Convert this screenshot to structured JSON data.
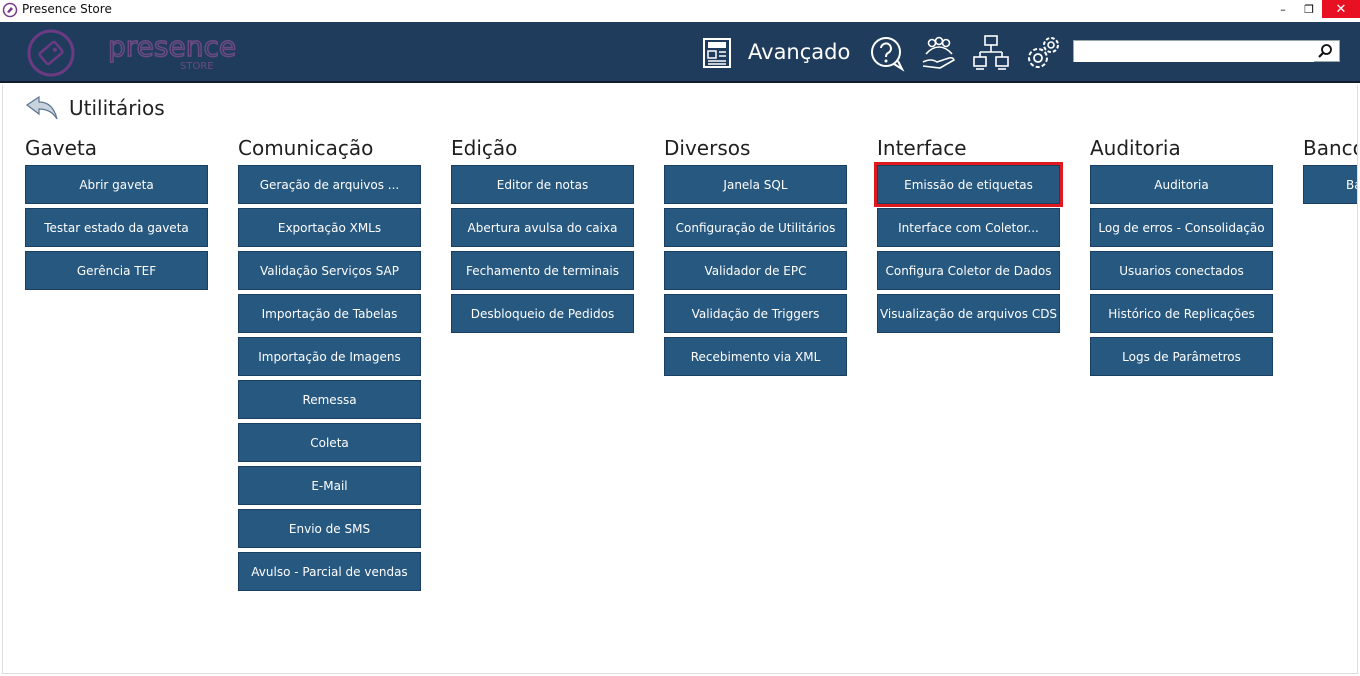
{
  "window": {
    "title": "Presence Store",
    "minimize": "–",
    "restore": "❐",
    "close": "✕"
  },
  "header": {
    "brand": "presence",
    "brand_sub": "STORE",
    "mode_label": "Avançado",
    "search_value": "",
    "icons": [
      "news-icon",
      "help-icon",
      "users-icon",
      "network-icon",
      "settings-icon",
      "search-icon"
    ],
    "colors": {
      "bg": "#203c5c",
      "button": "#275880",
      "highlight": "#e0191e"
    }
  },
  "page": {
    "title": "Utilitários"
  },
  "groups": [
    {
      "title": "Gaveta",
      "buttons": [
        "Abrir gaveta",
        "Testar estado da gaveta",
        "Gerência TEF"
      ]
    },
    {
      "title": "Comunicação",
      "buttons": [
        "Geração de arquivos ...",
        "Exportação XMLs",
        "Validação Serviços SAP",
        "Importação de Tabelas",
        "Importação de Imagens",
        "Remessa",
        "Coleta",
        "E-Mail",
        "Envio de SMS",
        "Avulso - Parcial de vendas"
      ]
    },
    {
      "title": "Edição",
      "buttons": [
        "Editor de notas",
        "Abertura avulsa do caixa",
        "Fechamento de terminais",
        "Desbloqueio de Pedidos"
      ]
    },
    {
      "title": "Diversos",
      "buttons": [
        "Janela SQL",
        "Configuração de Utilitários",
        "Validador de EPC",
        "Validação de Triggers",
        "Recebimento via XML"
      ]
    },
    {
      "title": "Interface",
      "buttons": [
        "Emissão de etiquetas",
        "Interface com Coletor...",
        "Configura Coletor de Dados",
        "Visualização de arquivos CDS"
      ]
    },
    {
      "title": "Auditoria",
      "buttons": [
        "Auditoria",
        "Log de erros  - Consolidação",
        "Usuarios conectados",
        "Histórico de Replicações",
        "Logs de Parâmetros"
      ]
    },
    {
      "title": "Banco",
      "buttons": [
        "Ba"
      ]
    }
  ]
}
